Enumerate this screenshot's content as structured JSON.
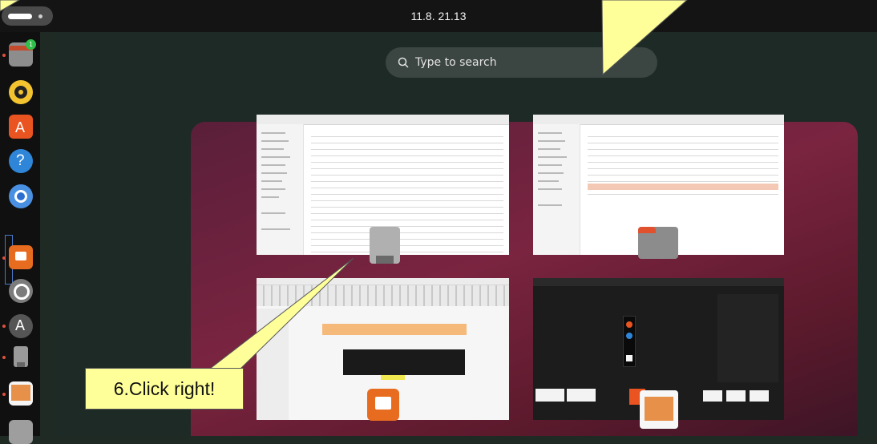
{
  "topbar": {
    "clock": "11.8.  21.13"
  },
  "search": {
    "placeholder": "Type to search"
  },
  "dock": {
    "items": [
      {
        "name": "files",
        "badge": "1"
      },
      {
        "name": "rhythmbox"
      },
      {
        "name": "app-center"
      },
      {
        "name": "help"
      },
      {
        "name": "chromium"
      },
      {
        "name": "impress"
      },
      {
        "name": "settings"
      },
      {
        "name": "software-updater"
      },
      {
        "name": "usb-drive"
      },
      {
        "name": "image-viewer"
      },
      {
        "name": "trash"
      }
    ]
  },
  "callout": {
    "text": "6.Click right!"
  },
  "colors": {
    "callout_fill": "#ffff99",
    "accent": "#e95420",
    "topbar": "#141414"
  }
}
